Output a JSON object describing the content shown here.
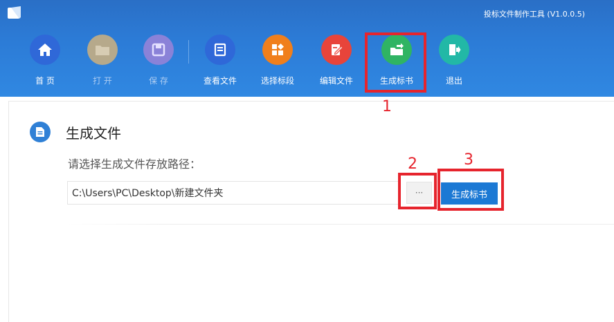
{
  "app": {
    "title": "投标文件制作工具 (V1.0.0.5)"
  },
  "toolbar": {
    "items": [
      {
        "label": "首 页",
        "icon": "home-icon",
        "color": "#2f68d8"
      },
      {
        "label": "打 开",
        "icon": "folder-icon",
        "color": "#b6a98b"
      },
      {
        "label": "保 存",
        "icon": "save-icon",
        "color": "#8a82d8"
      },
      {
        "label": "查看文件",
        "icon": "document-icon",
        "color": "#2f68d8"
      },
      {
        "label": "选择标段",
        "icon": "grid-icon",
        "color": "#f07f1c"
      },
      {
        "label": "编辑文件",
        "icon": "edit-icon",
        "color": "#e8443a"
      },
      {
        "label": "生成标书",
        "icon": "folder-export-icon",
        "color": "#2fb463"
      },
      {
        "label": "退出",
        "icon": "exit-icon",
        "color": "#22b8a6"
      }
    ]
  },
  "section": {
    "title": "生成文件",
    "prompt": "请选择生成文件存放路径："
  },
  "path": {
    "value": "C:\\Users\\PC\\Desktop\\新建文件夹"
  },
  "browse": {
    "label": "···"
  },
  "generate": {
    "label": "生成标书"
  },
  "annotations": [
    "1",
    "2",
    "3"
  ],
  "colors": {
    "annotation": "#e6242d",
    "primary": "#1c79d4",
    "header": "#2c7bd6"
  }
}
